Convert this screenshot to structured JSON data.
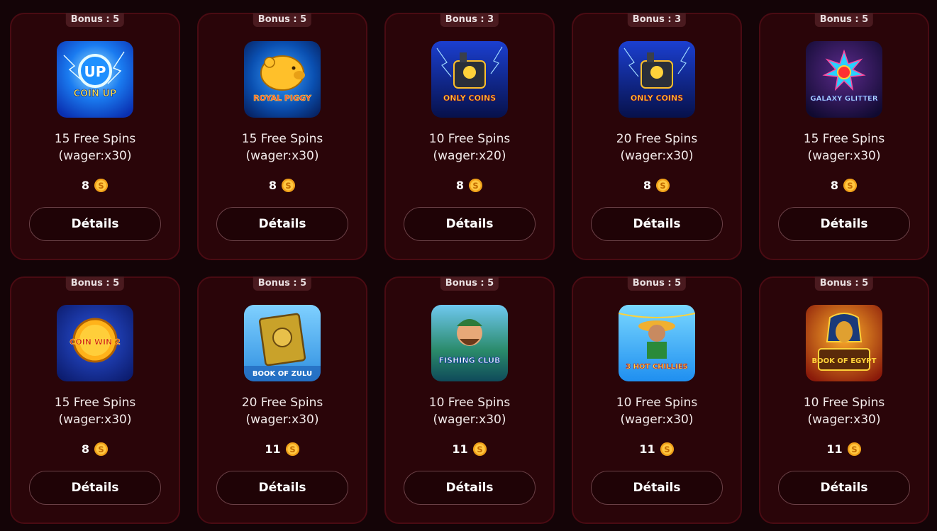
{
  "currency_icon": "gold-coin-icon",
  "colors": {
    "background": "#140407",
    "card": "#2a0509",
    "card_border": "#4a0b13",
    "badge": "#4a1a1f",
    "coin": "#f0a11a"
  },
  "cards": [
    {
      "badge": "Bonus : 5",
      "game": "coin-up-lightning",
      "logo": "COIN UP",
      "spins": "15 Free Spins",
      "wager": "(wager:x30)",
      "price": "8",
      "button": "Détails"
    },
    {
      "badge": "Bonus : 5",
      "game": "royal-piggy",
      "logo": "ROYAL PIGGY",
      "spins": "15 Free Spins",
      "wager": "(wager:x30)",
      "price": "8",
      "button": "Détails"
    },
    {
      "badge": "Bonus : 3",
      "game": "only-coins-express",
      "logo": "ONLY COINS",
      "spins": "10 Free Spins",
      "wager": "(wager:x20)",
      "price": "8",
      "button": "Détails"
    },
    {
      "badge": "Bonus : 3",
      "game": "only-coins-express",
      "logo": "ONLY COINS",
      "spins": "20 Free Spins",
      "wager": "(wager:x30)",
      "price": "8",
      "button": "Détails"
    },
    {
      "badge": "Bonus : 5",
      "game": "galaxy-glitter",
      "logo": "GALAXY GLITTER",
      "spins": "15 Free Spins",
      "wager": "(wager:x30)",
      "price": "8",
      "button": "Détails"
    },
    {
      "badge": "Bonus : 5",
      "game": "coin-win-2",
      "logo": "COIN WIN 2",
      "spins": "15 Free Spins",
      "wager": "(wager:x30)",
      "price": "8",
      "button": "Détails"
    },
    {
      "badge": "Bonus : 5",
      "game": "book-of-zulu",
      "logo": "BOOK OF ZULU",
      "spins": "20 Free Spins",
      "wager": "(wager:x30)",
      "price": "11",
      "button": "Détails"
    },
    {
      "badge": "Bonus : 5",
      "game": "fishing-club",
      "logo": "FISHING CLUB",
      "spins": "10 Free Spins",
      "wager": "(wager:x30)",
      "price": "11",
      "button": "Détails"
    },
    {
      "badge": "Bonus : 5",
      "game": "super-3-hot-chillies",
      "logo": "3 HOT CHILLIES",
      "spins": "10 Free Spins",
      "wager": "(wager:x30)",
      "price": "11",
      "button": "Détails"
    },
    {
      "badge": "Bonus : 5",
      "game": "book-of-egypt",
      "logo": "BOOK OF EGYPT",
      "spins": "10 Free Spins",
      "wager": "(wager:x30)",
      "price": "11",
      "button": "Détails"
    }
  ]
}
